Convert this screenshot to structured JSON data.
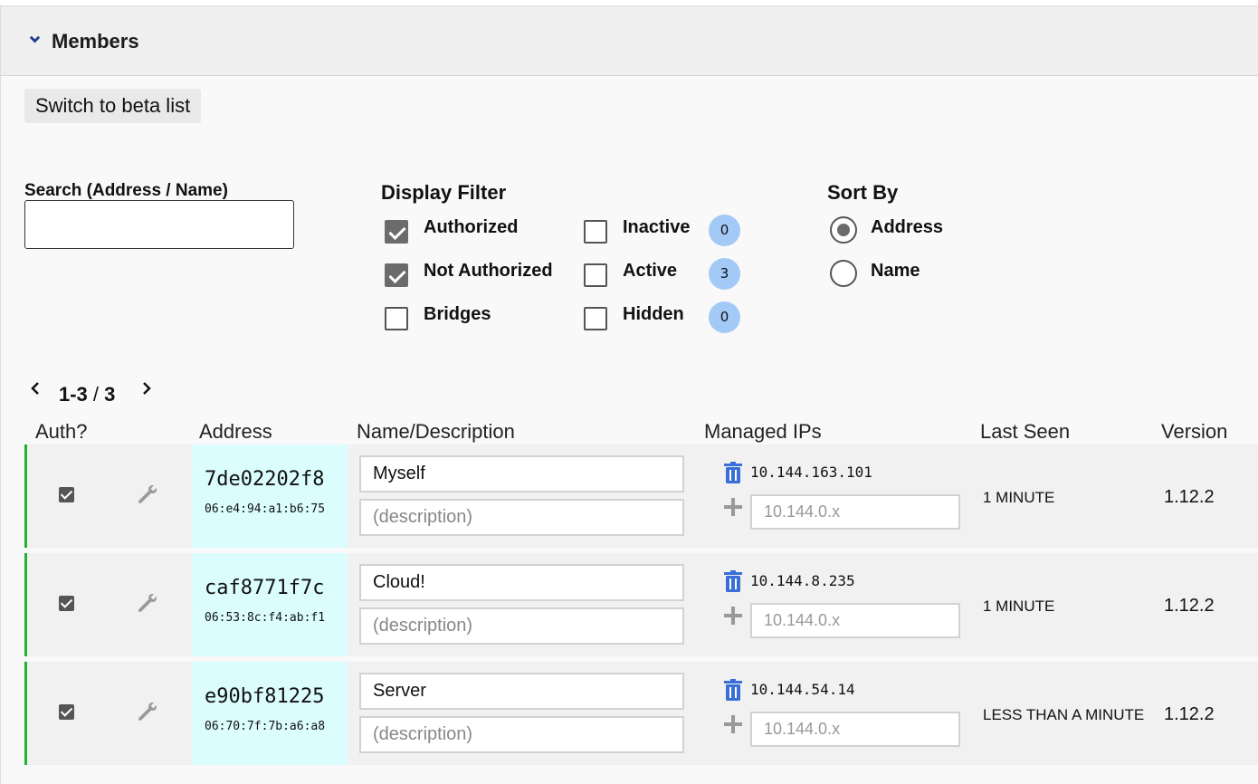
{
  "panel": {
    "title": "Members"
  },
  "beta_button": "Switch to beta list",
  "search": {
    "label": "Search (Address / Name)",
    "value": ""
  },
  "display_filter": {
    "title": "Display Filter",
    "options": [
      {
        "label": "Authorized",
        "checked": true
      },
      {
        "label": "Not Authorized",
        "checked": true
      },
      {
        "label": "Bridges",
        "checked": false
      },
      {
        "label": "Inactive",
        "checked": false,
        "count": "0"
      },
      {
        "label": "Active",
        "checked": false,
        "count": "3"
      },
      {
        "label": "Hidden",
        "checked": false,
        "count": "0"
      }
    ]
  },
  "sort_by": {
    "title": "Sort By",
    "options": [
      {
        "label": "Address",
        "selected": true
      },
      {
        "label": "Name",
        "selected": false
      }
    ]
  },
  "pager": {
    "range": "1-3",
    "separator": "/",
    "total": "3"
  },
  "columns": [
    "Auth?",
    "Address",
    "Name/Description",
    "Managed IPs",
    "Last Seen",
    "Version"
  ],
  "members": [
    {
      "authorized": true,
      "address": "7de02202f8",
      "mac": "06:e4:94:a1:b6:75",
      "name": "Myself",
      "description_placeholder": "(description)",
      "ip": "10.144.163.101",
      "ip_placeholder": "10.144.0.x",
      "last_seen": "1 MINUTE",
      "version": "1.12.2"
    },
    {
      "authorized": true,
      "address": "caf8771f7c",
      "mac": "06:53:8c:f4:ab:f1",
      "name": "Cloud!",
      "description_placeholder": "(description)",
      "ip": "10.144.8.235",
      "ip_placeholder": "10.144.0.x",
      "last_seen": "1 MINUTE",
      "version": "1.12.2"
    },
    {
      "authorized": true,
      "address": "e90bf81225",
      "mac": "06:70:7f:7b:a6:a8",
      "name": "Server",
      "description_placeholder": "(description)",
      "ip": "10.144.54.14",
      "ip_placeholder": "10.144.0.x",
      "last_seen": "LESS THAN A MINUTE",
      "version": "1.12.2"
    }
  ],
  "colors": {
    "accent_green": "#22b02f",
    "badge_blue": "#a3c9f7",
    "address_bg": "#dcfdfd",
    "icon_blue": "#3a6fd8"
  }
}
